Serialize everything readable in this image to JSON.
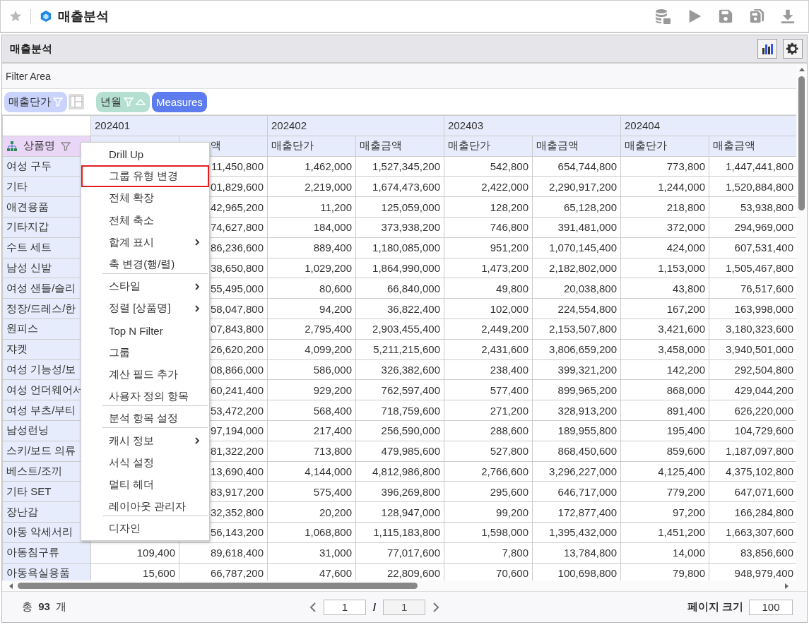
{
  "window": {
    "title": "매출분석"
  },
  "panel": {
    "title": "매출분석"
  },
  "filter_area": {
    "label": "Filter Area"
  },
  "pills": [
    {
      "label": "매출단가",
      "kind": "row"
    },
    {
      "label": "년월",
      "kind": "column"
    },
    {
      "label": "Measures",
      "kind": "measures"
    }
  ],
  "table": {
    "row_header": "상품명",
    "periods": [
      "202401",
      "202402",
      "202403",
      "202404"
    ],
    "measures": [
      "액",
      "매출단가",
      "매출금액",
      "매출단가",
      "매출금액",
      "매출단가",
      "매출금액"
    ],
    "rows": [
      {
        "name": "여성 구두",
        "values": [
          "11,450,800",
          "1,462,000",
          "1,527,345,200",
          "542,800",
          "654,744,800",
          "773,800",
          "1,447,441,800"
        ]
      },
      {
        "name": "기타",
        "values": [
          "01,829,600",
          "2,219,000",
          "1,674,473,600",
          "2,422,000",
          "2,290,917,200",
          "1,244,000",
          "1,520,884,800"
        ]
      },
      {
        "name": "애견용품",
        "values": [
          "42,965,200",
          "11,200",
          "125,059,000",
          "128,200",
          "65,128,200",
          "218,800",
          "53,938,800"
        ]
      },
      {
        "name": "기타지갑",
        "values": [
          "74,627,800",
          "184,000",
          "373,938,200",
          "746,800",
          "391,481,000",
          "372,000",
          "294,969,000"
        ]
      },
      {
        "name": "수트 세트",
        "values": [
          "86,236,600",
          "889,400",
          "1,180,085,000",
          "951,200",
          "1,070,145,400",
          "424,000",
          "607,531,400"
        ]
      },
      {
        "name": "남성 신발",
        "values": [
          "38,650,800",
          "1,029,200",
          "1,864,990,000",
          "1,473,200",
          "2,182,802,000",
          "1,153,000",
          "1,505,467,800"
        ]
      },
      {
        "name": "여성 샌들/슬리",
        "values": [
          "55,495,000",
          "80,600",
          "66,840,000",
          "49,800",
          "20,038,800",
          "43,800",
          "76,517,600"
        ]
      },
      {
        "name": "정장/드레스/한",
        "values": [
          "58,047,800",
          "94,200",
          "36,822,400",
          "102,000",
          "224,554,800",
          "167,200",
          "163,998,000"
        ]
      },
      {
        "name": "원피스",
        "values": [
          "07,843,800",
          "2,795,400",
          "2,903,455,400",
          "2,449,200",
          "2,153,507,800",
          "3,421,600",
          "3,180,323,600"
        ]
      },
      {
        "name": "쟈켓",
        "values": [
          "26,620,200",
          "4,099,200",
          "5,211,215,600",
          "2,431,600",
          "3,806,659,200",
          "3,458,000",
          "3,940,501,000"
        ]
      },
      {
        "name": "여성 기능성/보",
        "values": [
          "08,866,000",
          "586,000",
          "326,382,600",
          "238,400",
          "399,321,200",
          "142,200",
          "292,504,800"
        ]
      },
      {
        "name": "여성 언더웨어서",
        "values": [
          "60,241,400",
          "929,200",
          "762,597,400",
          "577,400",
          "899,965,200",
          "868,000",
          "429,044,200"
        ]
      },
      {
        "name": "여성 부츠/부티",
        "values": [
          "53,472,200",
          "568,400",
          "718,759,600",
          "271,200",
          "328,913,200",
          "891,400",
          "626,220,000"
        ]
      },
      {
        "name": "남성런닝",
        "values": [
          "97,194,000",
          "217,400",
          "256,590,000",
          "288,600",
          "189,955,800",
          "195,400",
          "104,729,600"
        ]
      },
      {
        "name": "스키/보드 의류",
        "values": [
          "81,322,200",
          "713,800",
          "479,985,600",
          "527,800",
          "868,450,600",
          "859,600",
          "1,187,097,800"
        ]
      },
      {
        "name": "베스트/조끼",
        "values": [
          "13,690,400",
          "4,144,000",
          "4,812,986,800",
          "2,766,600",
          "3,296,227,000",
          "4,125,400",
          "4,375,102,800"
        ]
      },
      {
        "name": "기타 SET",
        "values": [
          "83,917,200",
          "575,400",
          "396,269,800",
          "295,600",
          "646,717,000",
          "779,200",
          "647,071,600"
        ]
      },
      {
        "name": "장난감",
        "values": [
          "32,352,800",
          "20,200",
          "128,947,000",
          "99,200",
          "172,877,400",
          "97,200",
          "166,284,800"
        ]
      },
      {
        "name": "아동 악세서리",
        "values": [
          "56,143,200",
          "1,068,800",
          "1,115,183,800",
          "1,598,000",
          "1,395,432,000",
          "1,451,200",
          "1,663,307,600"
        ]
      },
      {
        "name": "아동침구류",
        "values": [
          "109,400",
          "89,618,400",
          "31,000",
          "77,017,600",
          "7,800",
          "13,784,800",
          "14,000",
          "83,856,600"
        ]
      },
      {
        "name": "아동욕실용품",
        "values": [
          "15,600",
          "66,787,200",
          "47,600",
          "22,809,600",
          "70,600",
          "100,698,800",
          "79,800",
          "948,979,400"
        ]
      }
    ]
  },
  "context_menu": [
    {
      "label": "Drill Up",
      "selected": false,
      "submenu": false,
      "divider_after": false
    },
    {
      "label": "그룹 유형 변경",
      "selected": true,
      "submenu": false,
      "divider_after": false
    },
    {
      "label": "전체 확장",
      "selected": false,
      "submenu": false,
      "divider_after": false
    },
    {
      "label": "전체 축소",
      "selected": false,
      "submenu": false,
      "divider_after": false
    },
    {
      "label": "합계 표시",
      "selected": false,
      "submenu": true,
      "divider_after": false
    },
    {
      "label": "축 변경(행/렬)",
      "selected": false,
      "submenu": false,
      "divider_after": true
    },
    {
      "label": "스타일",
      "selected": false,
      "submenu": true,
      "divider_after": false
    },
    {
      "label": "정렬 [상품명]",
      "selected": false,
      "submenu": true,
      "divider_after": false
    },
    {
      "label": "Top N Filter",
      "selected": false,
      "submenu": false,
      "divider_after": false
    },
    {
      "label": "그룹",
      "selected": false,
      "submenu": false,
      "divider_after": false
    },
    {
      "label": "계산 필드 추가",
      "selected": false,
      "submenu": false,
      "divider_after": false
    },
    {
      "label": "사용자 정의 항목",
      "selected": false,
      "submenu": false,
      "divider_after": true
    },
    {
      "label": "분석 항목 설정",
      "selected": false,
      "submenu": false,
      "divider_after": true
    },
    {
      "label": "캐시 정보",
      "selected": false,
      "submenu": true,
      "divider_after": false
    },
    {
      "label": "서식 설정",
      "selected": false,
      "submenu": false,
      "divider_after": false
    },
    {
      "label": "멀티 헤더",
      "selected": false,
      "submenu": false,
      "divider_after": false
    },
    {
      "label": "레이아웃 관리자",
      "selected": false,
      "submenu": false,
      "divider_after": true
    },
    {
      "label": "디자인",
      "selected": false,
      "submenu": false,
      "divider_after": false
    }
  ],
  "footer": {
    "total": "총 **93** 개",
    "page": "1",
    "separator": "/",
    "page_count": "1",
    "page_size_label": "페이지 크기",
    "page_size": "100"
  }
}
